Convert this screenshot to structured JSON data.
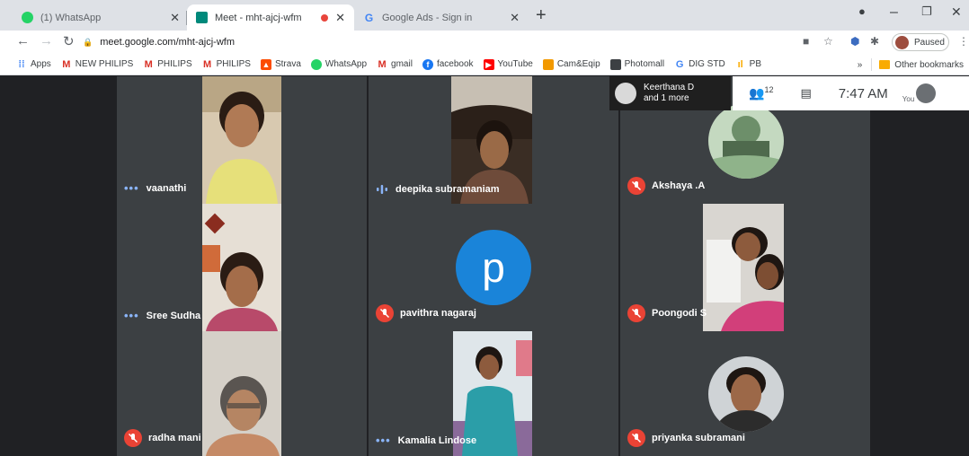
{
  "browser": {
    "tabs": [
      {
        "title": "(1) WhatsApp",
        "icon": "whatsapp-icon",
        "color": "#25d366",
        "badge": "1"
      },
      {
        "title": "Meet - mht-ajcj-wfm",
        "icon": "meet-icon",
        "color": "#00897b"
      },
      {
        "title": "Google Ads - Sign in",
        "icon": "google-icon",
        "color": "#4285f4"
      }
    ],
    "url": "meet.google.com/mht-ajcj-wfm",
    "profile_label": "Paused",
    "bookmarks": [
      {
        "label": "Apps",
        "icon": "apps-grid-icon",
        "color": "#4285f4"
      },
      {
        "label": "NEW PHILIPS",
        "icon": "gmail-icon",
        "color": "#d93025"
      },
      {
        "label": "PHILIPS",
        "icon": "gmail-icon",
        "color": "#d93025"
      },
      {
        "label": "PHILIPS",
        "icon": "gmail-icon",
        "color": "#d93025"
      },
      {
        "label": "Strava",
        "icon": "strava-icon",
        "color": "#fc4c02"
      },
      {
        "label": "WhatsApp",
        "icon": "whatsapp-icon",
        "color": "#25d366"
      },
      {
        "label": "gmail",
        "icon": "gmail-icon",
        "color": "#d93025"
      },
      {
        "label": "facebook",
        "icon": "facebook-icon",
        "color": "#1877f2"
      },
      {
        "label": "YouTube",
        "icon": "youtube-icon",
        "color": "#ff0000"
      },
      {
        "label": "Cam&Eqip",
        "icon": "bookmark-icon",
        "color": "#f29900"
      },
      {
        "label": "Photomall",
        "icon": "photomall-icon",
        "color": "#3c4043"
      },
      {
        "label": "DIG STD",
        "icon": "google-icon",
        "color": "#4285f4"
      },
      {
        "label": "PB",
        "icon": "analytics-icon",
        "color": "#f9ab00"
      }
    ],
    "other_bookmarks": "Other bookmarks"
  },
  "meet": {
    "presenter": {
      "line1": "Keerthana D",
      "line2": "and 1 more"
    },
    "people_count": "12",
    "time": "7:47 AM",
    "self_label": "You",
    "participants": [
      {
        "name": "vaanathi",
        "status": "speaking-dots"
      },
      {
        "name": "deepika subramaniam",
        "status": "speaking-eq"
      },
      {
        "name": "Akshaya .A",
        "status": "muted"
      },
      {
        "name": "Sree Sudha",
        "status": "speaking-dots"
      },
      {
        "name": "pavithra nagaraj",
        "status": "muted",
        "avatar_letter": "p",
        "avatar_color": "#1a84d9"
      },
      {
        "name": "Poongodi S",
        "status": "muted"
      },
      {
        "name": "radha mani",
        "status": "muted"
      },
      {
        "name": "Kamalia Lindose",
        "status": "speaking-dots"
      },
      {
        "name": "priyanka subramani",
        "status": "muted"
      }
    ]
  }
}
